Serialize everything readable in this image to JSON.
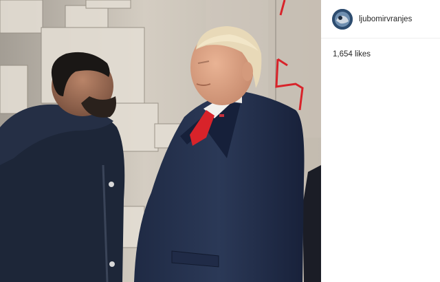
{
  "post": {
    "image_alt": "Man in a dark parka looking at a wax figure in a navy suit and red tie",
    "accent_tie_color": "#d8232a"
  },
  "account": {
    "username": "ljubomirvranjes",
    "avatar_icon": "profile-avatar-icon"
  },
  "engagement": {
    "likes_text": "1,654 likes",
    "likes_count": 1654
  }
}
